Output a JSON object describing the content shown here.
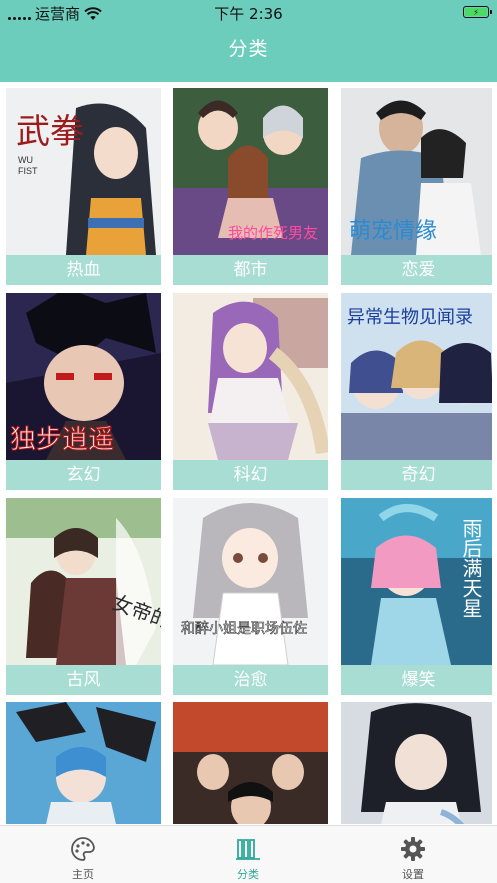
{
  "status_bar": {
    "carrier": "运营商",
    "time": "下午 2:36"
  },
  "header": {
    "title": "分类"
  },
  "categories": [
    {
      "label": "热血",
      "cover_icon": "wu-fist-comic-cover",
      "cover_text": "武拳"
    },
    {
      "label": "都市",
      "cover_icon": "city-couple-comic-cover",
      "cover_text": "我的作死男友"
    },
    {
      "label": "恋爱",
      "cover_icon": "romance-photo-cover",
      "cover_text": "萌宠情缘"
    },
    {
      "label": "玄幻",
      "cover_icon": "dark-hero-comic-cover",
      "cover_text": "独步逍遥"
    },
    {
      "label": "科幻",
      "cover_icon": "purple-hair-girl-cover",
      "cover_text": ""
    },
    {
      "label": "奇幻",
      "cover_icon": "strange-creatures-cover",
      "cover_text": "异常生物见闻录"
    },
    {
      "label": "古风",
      "cover_icon": "ancient-couple-cover",
      "cover_text": "女帝的后宫"
    },
    {
      "label": "治愈",
      "cover_icon": "cute-girl-cover",
      "cover_text": "和醉小姐是职场伍佐"
    },
    {
      "label": "爆笑",
      "cover_icon": "pink-hair-girl-cover",
      "cover_text": "雨后满天星"
    },
    {
      "label": "",
      "cover_icon": "blue-hair-boy-cover",
      "cover_text": ""
    },
    {
      "label": "",
      "cover_icon": "group-fight-cover",
      "cover_text": ""
    },
    {
      "label": "",
      "cover_icon": "dark-hair-girl-cover",
      "cover_text": ""
    }
  ],
  "tabbar": {
    "items": [
      {
        "label": "主页",
        "icon": "palette-icon"
      },
      {
        "label": "分类",
        "icon": "books-icon"
      },
      {
        "label": "设置",
        "icon": "gear-icon"
      }
    ],
    "active_color": "#2fa89a"
  },
  "colors": {
    "accent": "#6ccdbc",
    "label_bg": "#a7ddd3"
  }
}
